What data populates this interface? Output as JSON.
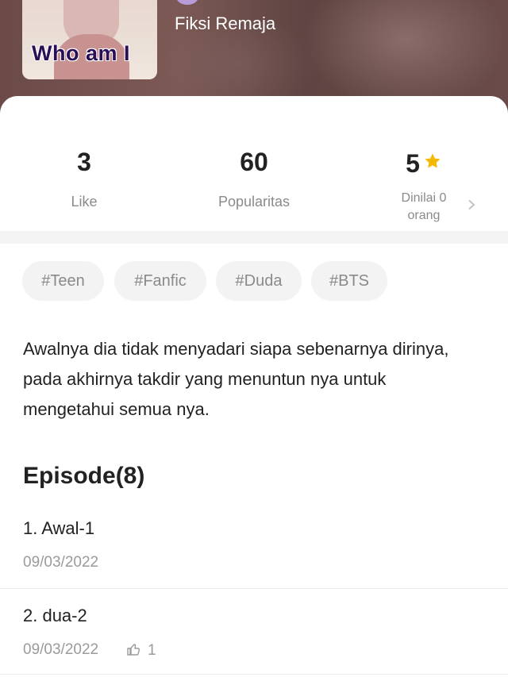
{
  "cover": {
    "title": "Who am I"
  },
  "header": {
    "genre": "Fiksi Remaja"
  },
  "stats": {
    "likes": {
      "value": "3",
      "label": "Like"
    },
    "popularity": {
      "value": "60",
      "label": "Popularitas"
    },
    "rating": {
      "value": "5",
      "label_line1": "Dinilai 0",
      "label_line2": "orang"
    }
  },
  "tags": [
    "#Teen",
    "#Fanfic",
    "#Duda",
    "#BTS"
  ],
  "description": "Awalnya dia tidak menyadari siapa sebenarnya dirinya, pada akhirnya takdir yang menuntun nya untuk mengetahui semua nya.",
  "episodes_section": {
    "title": "Episode(8)",
    "items": [
      {
        "name": "1. Awal-1",
        "date": "09/03/2022",
        "likes": ""
      },
      {
        "name": "2. dua-2",
        "date": "09/03/2022",
        "likes": "1"
      }
    ]
  },
  "colors": {
    "star": "#f5b800",
    "accent_text": "#222222",
    "muted": "#8a8a8a"
  },
  "icons": {
    "rating": "star-icon",
    "more": "chevron-right-icon",
    "like": "thumbs-up-icon"
  }
}
